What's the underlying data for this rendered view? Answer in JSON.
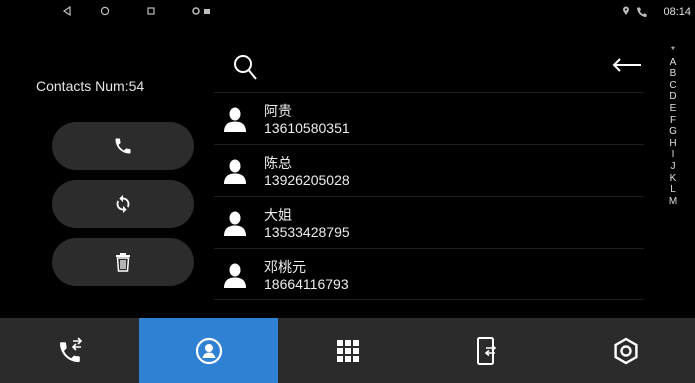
{
  "status_bar": {
    "time": "08:14",
    "icons": [
      "back-triangle",
      "home-circle",
      "recents-square",
      "location-dot",
      "media-box",
      "location-icon",
      "phone-icon"
    ]
  },
  "left_panel": {
    "contacts_count_text": "Contacts Num:54",
    "buttons": [
      "call-button",
      "sync-button",
      "delete-button"
    ]
  },
  "contacts": [
    {
      "name": "阿贵",
      "phone": "13610580351"
    },
    {
      "name": "陈总",
      "phone": "13926205028"
    },
    {
      "name": "大姐",
      "phone": "13533428795"
    },
    {
      "name": "邓桃元",
      "phone": "18664116793"
    }
  ],
  "alphabet_index": [
    "*",
    "A",
    "B",
    "C",
    "D",
    "E",
    "F",
    "G",
    "H",
    "I",
    "J",
    "K",
    "L",
    "M"
  ],
  "bottom_nav": [
    {
      "icon": "call-transfer-icon",
      "active": false
    },
    {
      "icon": "contacts-icon",
      "active": true
    },
    {
      "icon": "dialpad-icon",
      "active": false
    },
    {
      "icon": "phone-sync-icon",
      "active": false
    },
    {
      "icon": "settings-icon",
      "active": false
    }
  ],
  "colors": {
    "accent": "#2f82d3",
    "background": "#000000",
    "nav_background": "#2b2b2b",
    "button_background": "#2c2c2c"
  }
}
